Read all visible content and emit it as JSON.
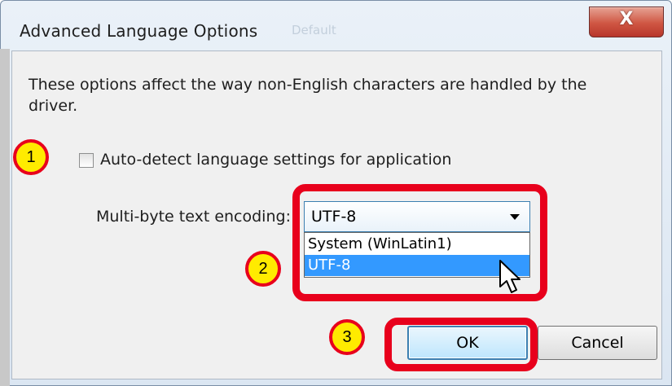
{
  "dialog": {
    "title": "Advanced Language Options",
    "title_ghost": "Default",
    "close_label": "X",
    "description": "These options affect the way non-English characters are handled by the driver.",
    "auto_detect": {
      "label": "Auto-detect language settings for application",
      "checked": false
    },
    "encoding": {
      "label": "Multi-byte text encoding:",
      "selected": "UTF-8",
      "options": [
        "System (WinLatin1)",
        "UTF-8"
      ],
      "highlighted_option": "UTF-8"
    },
    "buttons": {
      "ok": "OK",
      "cancel": "Cancel"
    }
  },
  "annotations": {
    "badge1": "1",
    "badge2": "2",
    "badge3": "3",
    "badge_color": "#ffeb00",
    "highlight_color": "#e8001c"
  },
  "colors": {
    "selection": "#3399ff",
    "dialog_face": "#f0f0f0",
    "close_button": "#cf5643"
  }
}
